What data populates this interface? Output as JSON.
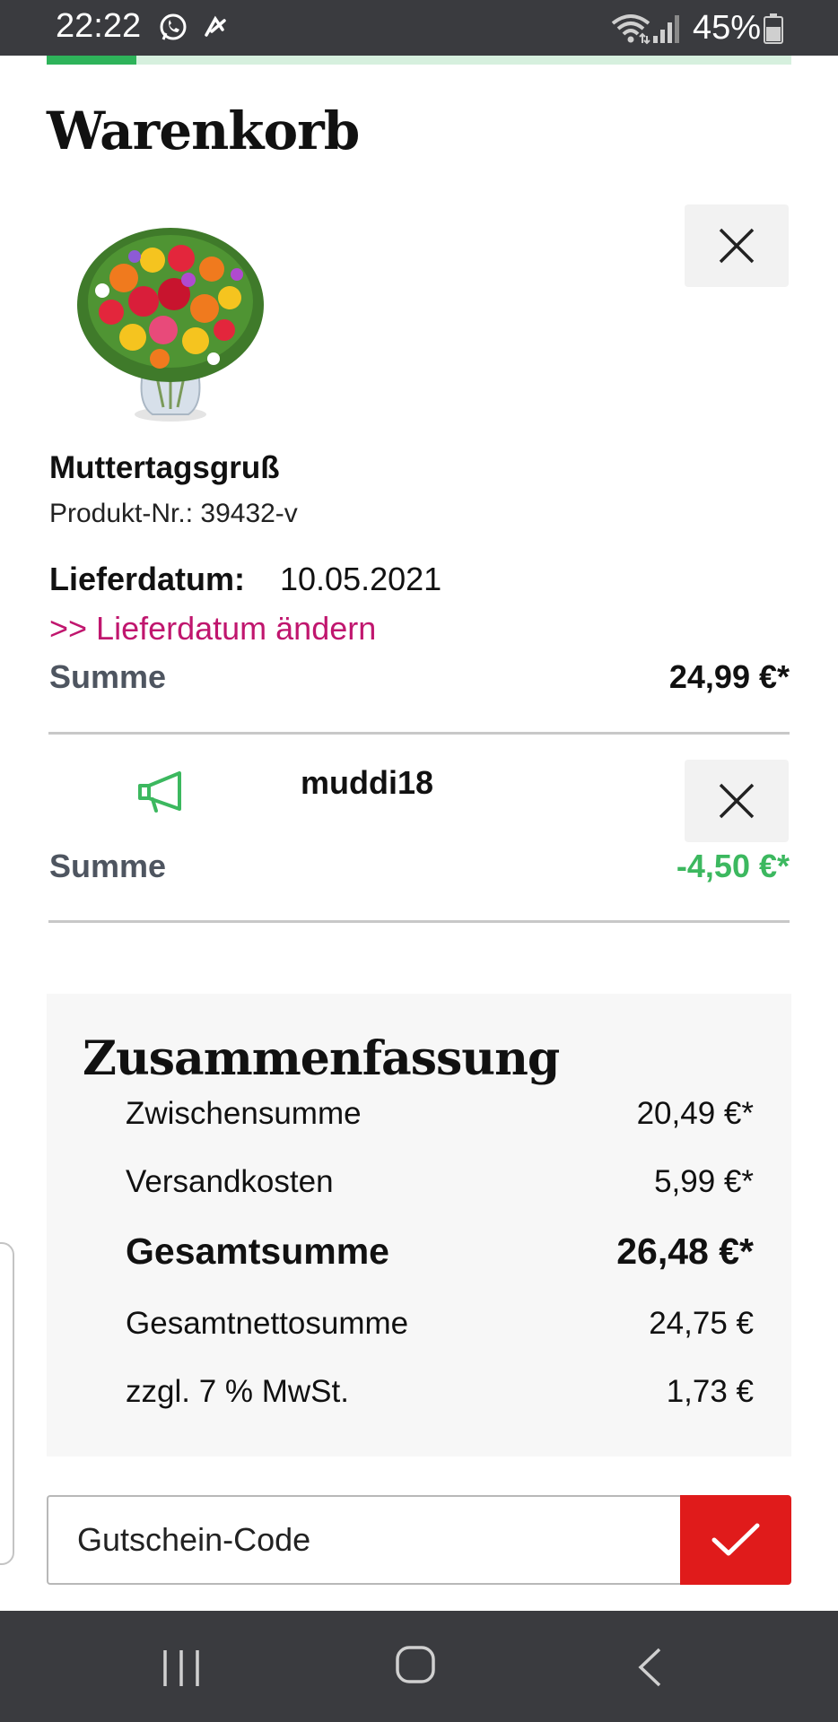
{
  "status_bar": {
    "time": "22:22",
    "battery": "45%",
    "icons": [
      "whatsapp-icon",
      "signal-app-icon",
      "wifi-icon",
      "cell-signal-icon",
      "battery-icon"
    ]
  },
  "progress": {
    "fraction": 0.12,
    "color": "#2eb35a"
  },
  "page_title": "Warenkorb",
  "cart_item": {
    "name": "Muttertagsgruß",
    "product_number": "Produkt-Nr.: 39432-v",
    "delivery_label": "Lieferdatum:",
    "delivery_date": "10.05.2021",
    "change_date_link": ">> Lieferdatum ändern",
    "sum_label": "Summe",
    "sum_value": "24,99 €*"
  },
  "voucher": {
    "code": "muddi18",
    "sum_label": "Summe",
    "sum_value": "-4,50 €*",
    "sum_color": "#3cb85f"
  },
  "summary": {
    "title": "Zusammenfassung",
    "rows": [
      {
        "label": "Zwischensumme",
        "value": "20,49 €*"
      },
      {
        "label": "Versandkosten",
        "value": "5,99 €*"
      },
      {
        "label": "Gesamtsumme",
        "value": "26,48 €*"
      },
      {
        "label": "Gesamtnettosumme",
        "value": "24,75 €"
      },
      {
        "label": "zzgl. 7 % MwSt.",
        "value": "1,73 €"
      }
    ]
  },
  "coupon": {
    "placeholder": "Gutschein-Code",
    "button_color": "#e01b1b"
  },
  "colors": {
    "link": "#c0166e",
    "accent_green": "#2eb35a",
    "summary_bg": "#f7f7f7"
  }
}
